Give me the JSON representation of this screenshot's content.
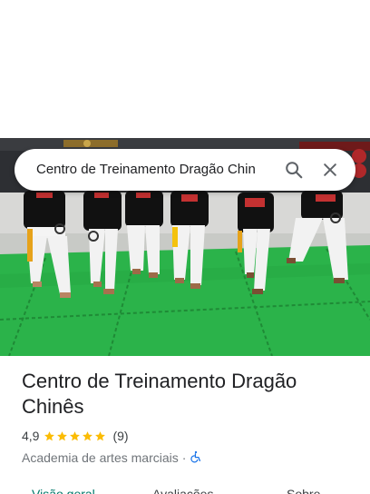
{
  "search": {
    "query": "Centro de Treinamento Dragão Chin",
    "search_icon": "search-icon",
    "close_icon": "close-icon"
  },
  "hero": {
    "photo_icon": "place-photo"
  },
  "place": {
    "title": "Centro de Treinamento Dragão Chinês",
    "rating_value": "4,9",
    "rating_stars": 5,
    "reviews": "(9)",
    "category": "Academia de artes marciais",
    "separator": "·",
    "accessibility_icon": "wheelchair-accessible-icon"
  },
  "tabs": [
    {
      "label": "Visão geral",
      "active": true
    },
    {
      "label": "Avaliações",
      "active": false
    },
    {
      "label": "Sobre",
      "active": false
    }
  ],
  "colors": {
    "accent": "#00796b",
    "star": "#fbbc04",
    "access": "#1a73e8",
    "mat": "#2bb34a"
  }
}
